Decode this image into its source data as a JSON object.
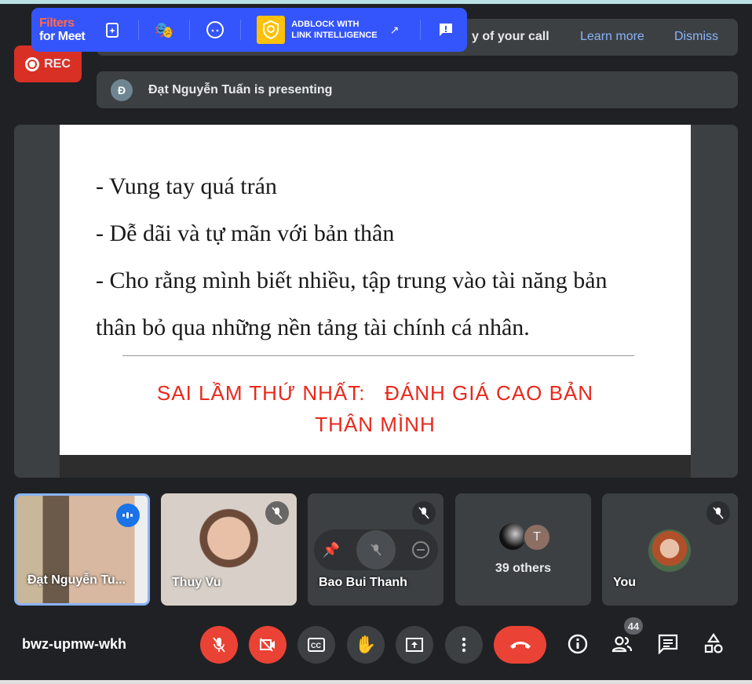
{
  "extension": {
    "brand_line1": "Filters",
    "brand_line2": "for Meet",
    "adblock_line1": "ADBLOCK WITH",
    "adblock_line2": "LINK INTELLIGENCE",
    "icons": [
      "effects-icon",
      "masks-icon",
      "face-icon",
      "shield-icon",
      "external-link-icon",
      "feedback-icon"
    ]
  },
  "notice": {
    "text": "y of your call",
    "learn_more": "Learn more",
    "dismiss": "Dismiss"
  },
  "rec": {
    "label": "REC"
  },
  "presenting": {
    "initial": "Đ",
    "text": "Đạt Nguyễn Tuấn is presenting"
  },
  "slide": {
    "lines": [
      "- Vung tay quá trán",
      "- Dễ dãi và tự mãn với bản thân",
      "- Cho rằng mình biết nhiều, tập trung vào tài năng bản",
      "thân bỏ qua những nền tảng tài chính cá nhân."
    ],
    "heading_line1": "SAI LẦM THỨ NHẤT:   ĐÁNH GIÁ CAO BẢN",
    "heading_line2": "THÂN MÌNH",
    "heading_color": "#e8291c"
  },
  "tiles": [
    {
      "name": "Đạt Nguyễn Tu...",
      "speaking": true
    },
    {
      "name": "Thuy Vu",
      "muted": true
    },
    {
      "name": "Bao Bui Thanh",
      "muted": true
    },
    {
      "name": "39 others",
      "avatar_initial": "T"
    },
    {
      "name": "You",
      "muted": true
    }
  ],
  "meeting": {
    "code": "bwz-upmw-wkh",
    "participant_count": "44"
  },
  "colors": {
    "accent": "#8ab4f8",
    "danger": "#ea4335",
    "background": "#202124",
    "surface": "#3c4043"
  }
}
